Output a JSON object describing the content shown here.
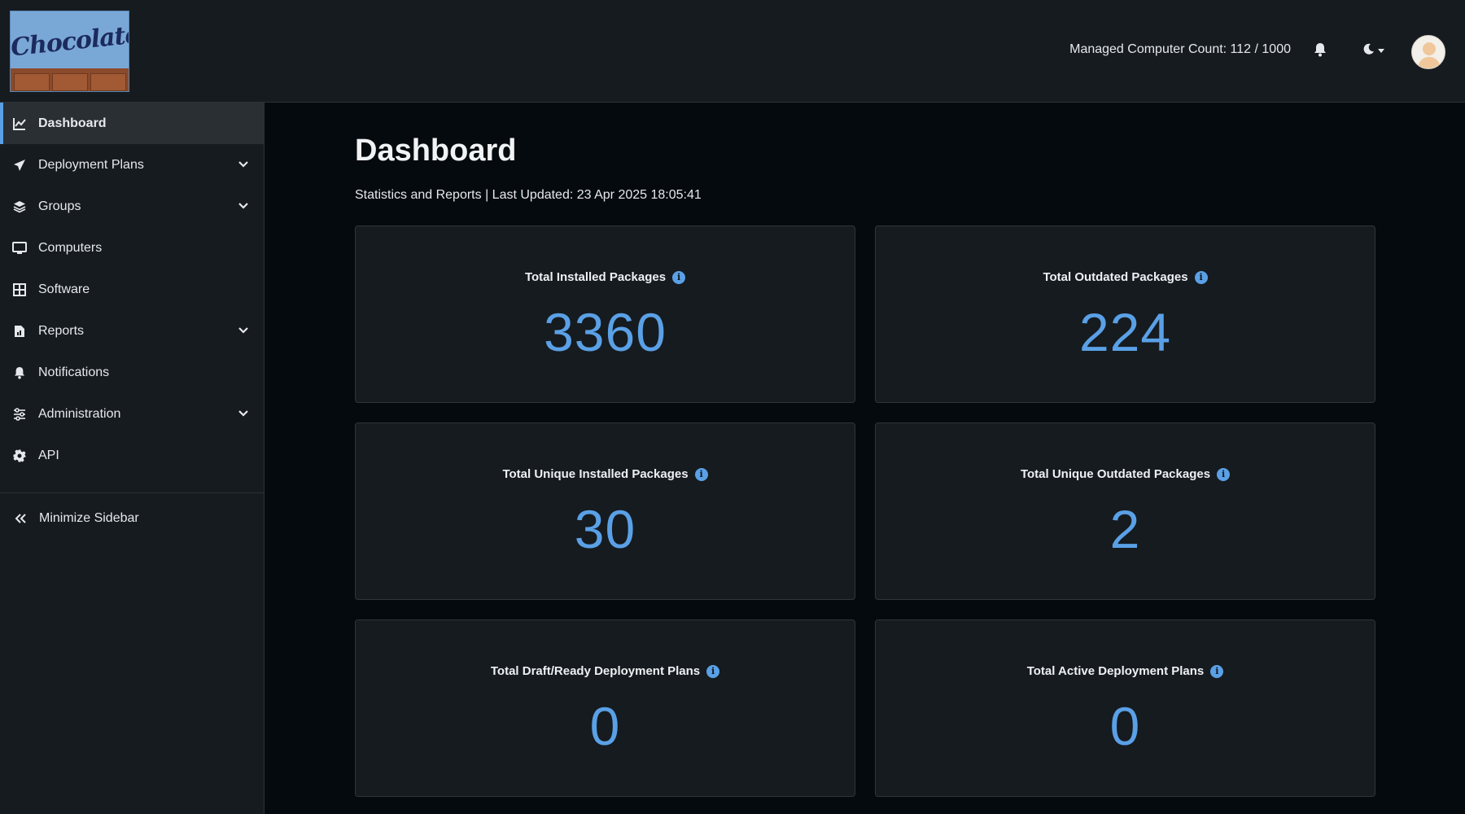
{
  "header": {
    "logo_text": "Chocolatey",
    "managed_count_label": "Managed Computer Count: 112 / 1000"
  },
  "sidebar": {
    "items": [
      {
        "label": "Dashboard",
        "icon": "chart-line-icon",
        "active": true
      },
      {
        "label": "Deployment Plans",
        "icon": "paper-plane-icon",
        "has_children": true
      },
      {
        "label": "Groups",
        "icon": "layers-icon",
        "has_children": true
      },
      {
        "label": "Computers",
        "icon": "monitor-icon"
      },
      {
        "label": "Software",
        "icon": "grid-icon"
      },
      {
        "label": "Reports",
        "icon": "report-file-icon",
        "has_children": true
      },
      {
        "label": "Notifications",
        "icon": "bell-icon"
      },
      {
        "label": "Administration",
        "icon": "sliders-icon",
        "has_children": true
      },
      {
        "label": "API",
        "icon": "gear-icon"
      }
    ],
    "minimize_label": "Minimize Sidebar"
  },
  "main": {
    "title": "Dashboard",
    "subtitle": "Statistics and Reports | Last Updated: 23 Apr 2025 18:05:41",
    "cards": [
      {
        "label": "Total Installed Packages",
        "value": "3360"
      },
      {
        "label": "Total Outdated Packages",
        "value": "224"
      },
      {
        "label": "Total Unique Installed Packages",
        "value": "30"
      },
      {
        "label": "Total Unique Outdated Packages",
        "value": "2"
      },
      {
        "label": "Total Draft/Ready Deployment Plans",
        "value": "0"
      },
      {
        "label": "Total Active Deployment Plans",
        "value": "0"
      }
    ]
  },
  "colors": {
    "accent": "#5aa0e6",
    "background": "#050a0e",
    "panel": "#161b1f"
  }
}
